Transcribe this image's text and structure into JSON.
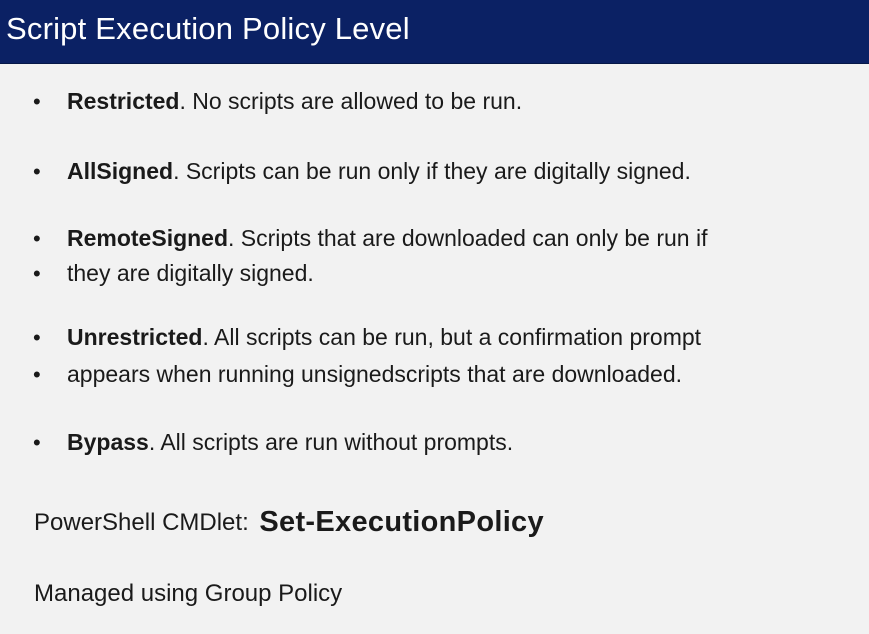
{
  "slide": {
    "title": "Script Execution Policy Level",
    "bullet_symbol": "•",
    "bullets": [
      {
        "term": "Restricted",
        "text": ". No scripts are allowed to be run."
      },
      {
        "term": "AllSigned",
        "text": ". Scripts can be run only if they are digitally signed."
      },
      {
        "term": "RemoteSigned",
        "text": ". Scripts that are downloaded can only be run if"
      },
      {
        "term": "",
        "text": "they are digitally signed."
      },
      {
        "term": "Unrestricted",
        "text": ". All scripts can be run, but a confirmation prompt"
      },
      {
        "term": "",
        "text": "appears when running unsignedscripts that are downloaded."
      },
      {
        "term": "Bypass",
        "text": ". All scripts are run without prompts."
      }
    ],
    "cmdlet_label": "PowerShell CMDlet:",
    "cmdlet_name": "Set-ExecutionPolicy",
    "footer": "Managed using Group Policy"
  },
  "colors": {
    "title_bar": "#0b2164",
    "title_text": "#ffffff",
    "background": "#f2f2f2",
    "body_text": "#1a1a1a"
  }
}
